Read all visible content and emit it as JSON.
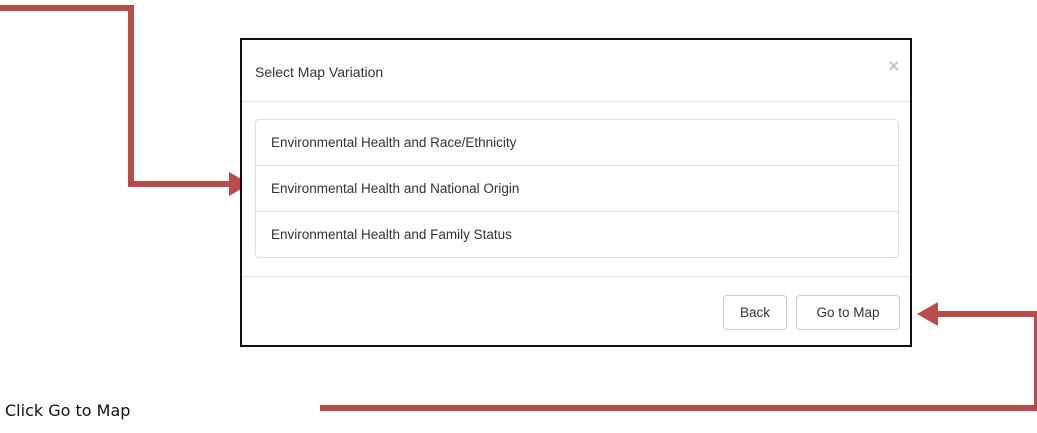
{
  "modal": {
    "title": "Select Map Variation",
    "close_glyph": "×",
    "options": [
      "Environmental Health and Race/Ethnicity",
      "Environmental Health and National Origin",
      "Environmental Health and Family Status"
    ],
    "back_label": "Back",
    "go_label": "Go to Map"
  },
  "caption": "Click Go to Map",
  "colors": {
    "arrow": "#b84c4a",
    "modal_border": "#111111",
    "text": "#333333"
  },
  "icons": [
    "close-icon",
    "arrow-right",
    "arrow-left"
  ]
}
